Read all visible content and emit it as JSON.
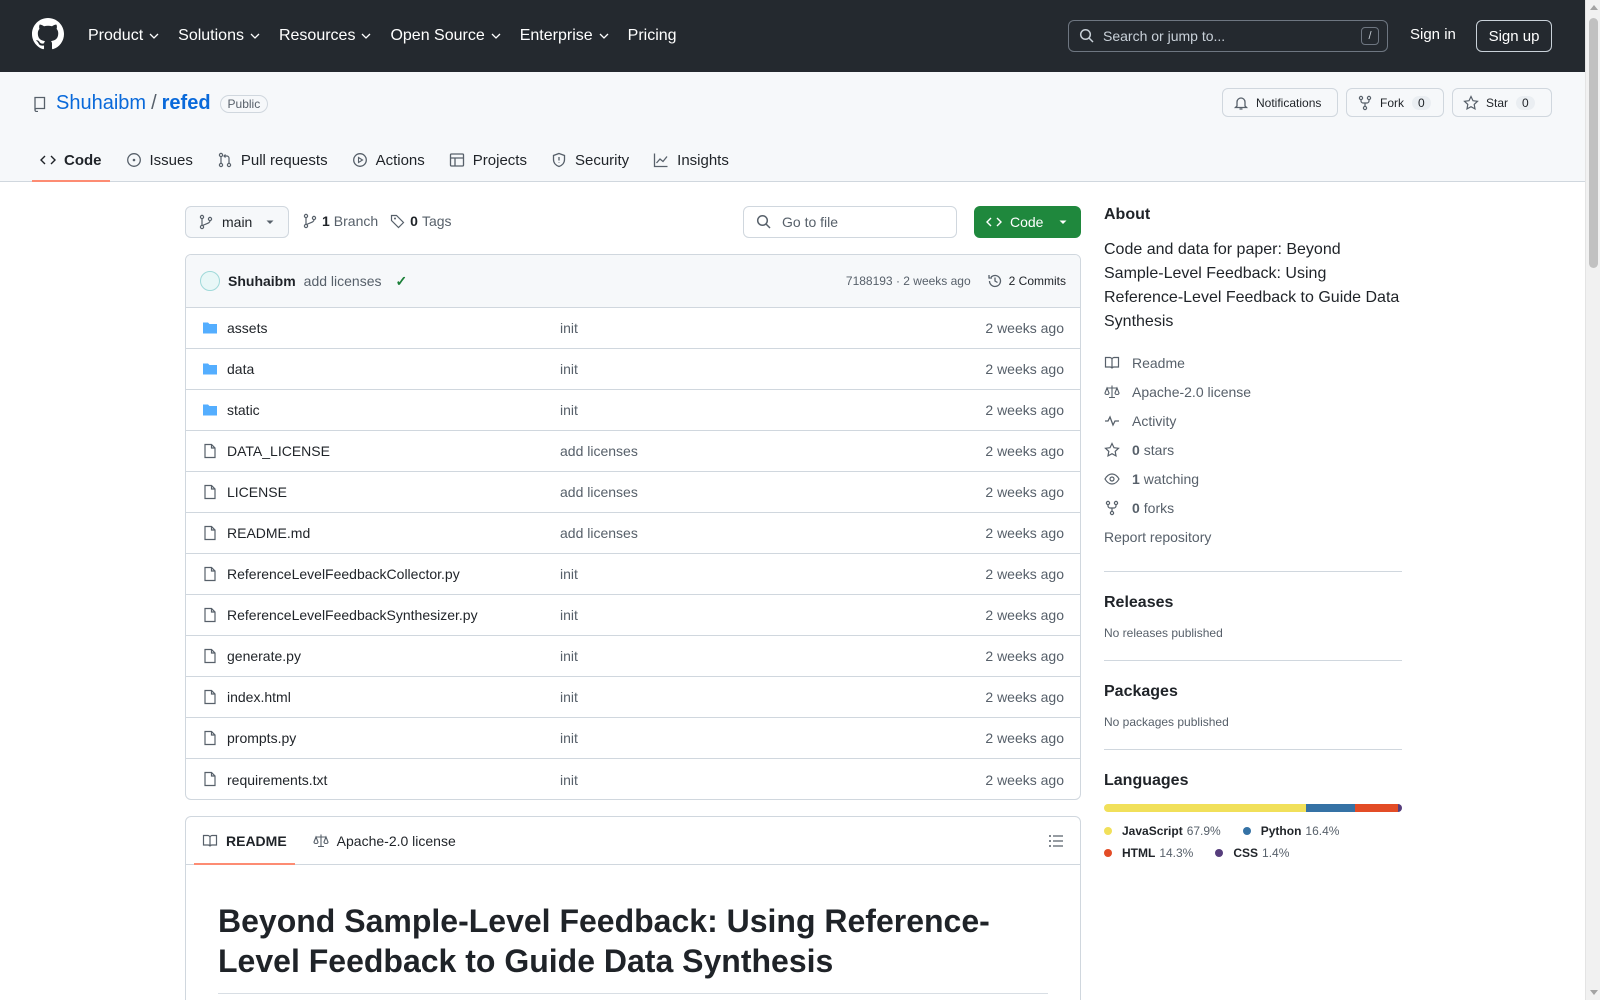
{
  "header": {
    "nav": [
      "Product",
      "Solutions",
      "Resources",
      "Open Source",
      "Enterprise",
      "Pricing"
    ],
    "search_placeholder": "Search or jump to...",
    "search_shortcut": "/",
    "signin": "Sign in",
    "signup": "Sign up"
  },
  "repo": {
    "owner": "Shuhaibm",
    "separator": "/",
    "name": "refed",
    "visibility": "Public",
    "notifications_label": "Notifications",
    "fork_label": "Fork",
    "fork_count": "0",
    "star_label": "Star",
    "star_count": "0",
    "tabs": [
      "Code",
      "Issues",
      "Pull requests",
      "Actions",
      "Projects",
      "Security",
      "Insights"
    ]
  },
  "toolbar": {
    "branch": "main",
    "branch_count": "1",
    "branch_label": "Branch",
    "tag_count": "0",
    "tag_label": "Tags",
    "goto_placeholder": "Go to file",
    "code_label": "Code"
  },
  "commit": {
    "author": "Shuhaibm",
    "message": "add licenses",
    "status": "✓",
    "sha_time": "7188193 · 2 weeks ago",
    "commits_label": "2 Commits"
  },
  "files": [
    {
      "name": "assets",
      "type": "dir",
      "msg": "init",
      "date": "2 weeks ago"
    },
    {
      "name": "data",
      "type": "dir",
      "msg": "init",
      "date": "2 weeks ago"
    },
    {
      "name": "static",
      "type": "dir",
      "msg": "init",
      "date": "2 weeks ago"
    },
    {
      "name": "DATA_LICENSE",
      "type": "file",
      "msg": "add licenses",
      "date": "2 weeks ago"
    },
    {
      "name": "LICENSE",
      "type": "file",
      "msg": "add licenses",
      "date": "2 weeks ago"
    },
    {
      "name": "README.md",
      "type": "file",
      "msg": "add licenses",
      "date": "2 weeks ago"
    },
    {
      "name": "ReferenceLevelFeedbackCollector.py",
      "type": "file",
      "msg": "init",
      "date": "2 weeks ago"
    },
    {
      "name": "ReferenceLevelFeedbackSynthesizer.py",
      "type": "file",
      "msg": "init",
      "date": "2 weeks ago"
    },
    {
      "name": "generate.py",
      "type": "file",
      "msg": "init",
      "date": "2 weeks ago"
    },
    {
      "name": "index.html",
      "type": "file",
      "msg": "init",
      "date": "2 weeks ago"
    },
    {
      "name": "prompts.py",
      "type": "file",
      "msg": "init",
      "date": "2 weeks ago"
    },
    {
      "name": "requirements.txt",
      "type": "file",
      "msg": "init",
      "date": "2 weeks ago"
    }
  ],
  "readme": {
    "tab_readme": "README",
    "tab_license": "Apache-2.0 license",
    "heading": "Beyond Sample-Level Feedback: Using Reference-Level Feedback to Guide Data Synthesis"
  },
  "sidebar": {
    "about_title": "About",
    "description": "Code and data for paper: Beyond Sample-Level Feedback: Using Reference-Level Feedback to Guide Data Synthesis",
    "readme": "Readme",
    "license": "Apache-2.0 license",
    "activity": "Activity",
    "stars_count": "0",
    "stars_label": "stars",
    "watching_count": "1",
    "watching_label": "watching",
    "forks_count": "0",
    "forks_label": "forks",
    "report": "Report repository",
    "releases_title": "Releases",
    "releases_text": "No releases published",
    "packages_title": "Packages",
    "packages_text": "No packages published",
    "languages_title": "Languages",
    "languages": [
      {
        "name": "JavaScript",
        "percent": "67.9%",
        "value": 67.9,
        "color": "#f1e05a"
      },
      {
        "name": "Python",
        "percent": "16.4%",
        "value": 16.4,
        "color": "#3572A5"
      },
      {
        "name": "HTML",
        "percent": "14.3%",
        "value": 14.3,
        "color": "#e34c26"
      },
      {
        "name": "CSS",
        "percent": "1.4%",
        "value": 1.4,
        "color": "#563d7c"
      }
    ]
  }
}
